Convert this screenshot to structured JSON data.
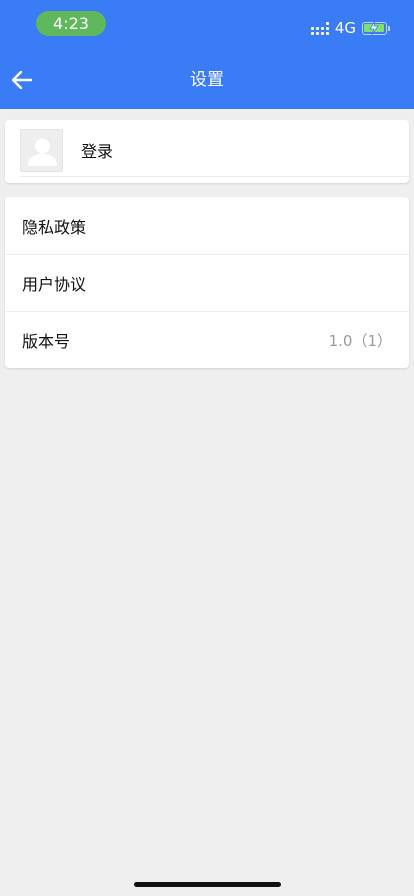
{
  "status_bar": {
    "time": "4:23",
    "network": "4G",
    "icons": [
      "signal-icon",
      "battery-charging-icon"
    ]
  },
  "header": {
    "title": "设置",
    "back_icon": "arrow-left-icon"
  },
  "login": {
    "label": "登录",
    "avatar_icon": "user-avatar-icon"
  },
  "settings": {
    "items": [
      {
        "label": "隐私政策"
      },
      {
        "label": "用户协议"
      },
      {
        "label": "版本号",
        "value": "1.0（1）"
      }
    ]
  },
  "colors": {
    "header_bg": "#3a7bf6",
    "time_pill": "#5fb95c",
    "page_bg": "#efefef"
  }
}
